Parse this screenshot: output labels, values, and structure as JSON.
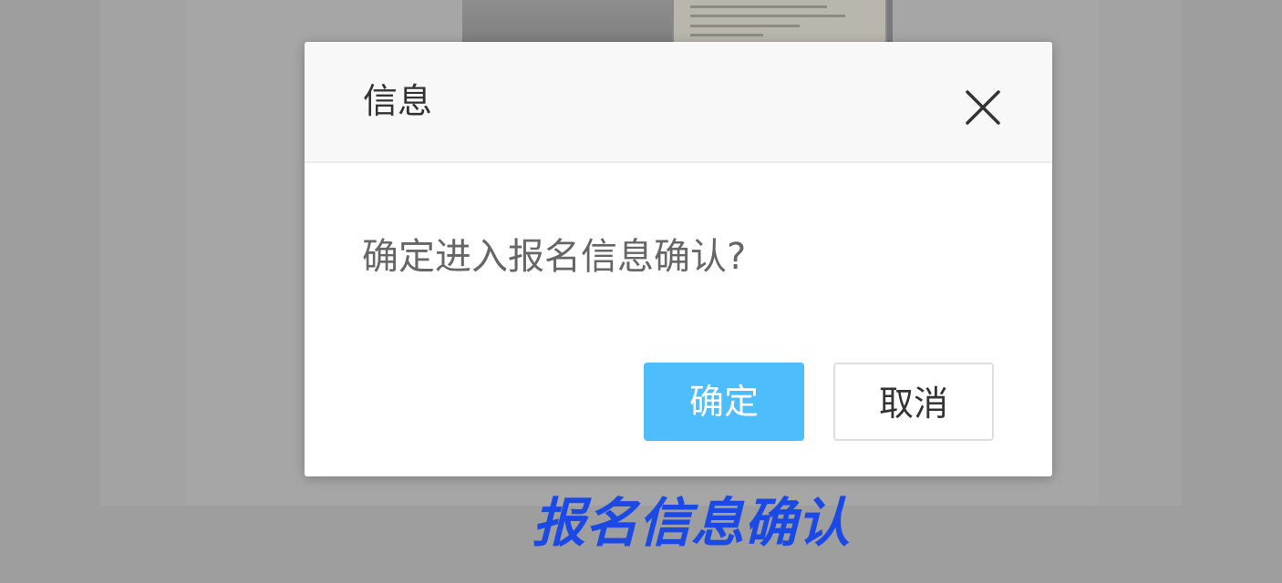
{
  "dialog": {
    "title": "信息",
    "close_icon": "close-icon",
    "message": "确定进入报名信息确认?",
    "confirm_label": "确定",
    "cancel_label": "取消"
  },
  "caption": "报名信息确认",
  "colors": {
    "confirm_button": "#4dbdfb",
    "caption": "#1a49e6",
    "overlay": "#9e9e9e"
  }
}
